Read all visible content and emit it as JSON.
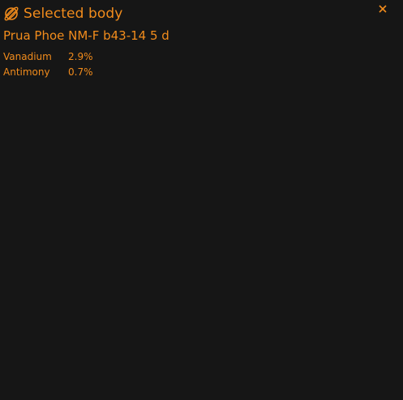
{
  "window": {
    "title": "Selected body",
    "body_name": "Prua Phoe NM-F b43-14 5 d",
    "header_icon": "planet-icon",
    "close_icon": "close-icon",
    "accent_color": "#f28c1c",
    "background_color": "#161616"
  },
  "materials": [
    {
      "name": "Vanadium",
      "percent": "2.9%"
    },
    {
      "name": "Antimony",
      "percent": "0.7%"
    }
  ]
}
